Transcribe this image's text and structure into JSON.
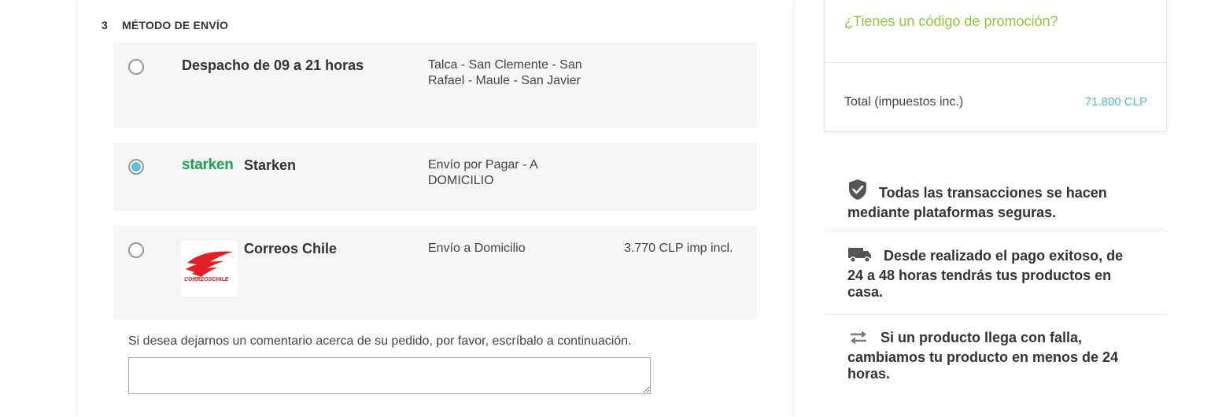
{
  "shipping": {
    "step_number": "3",
    "step_title": "MÉTODO DE ENVÍO",
    "options": [
      {
        "name": "Despacho de 09 a 21 horas",
        "description": "Talca - San Clemente - San Rafael - Maule - San Javier",
        "price": "",
        "selected": false
      },
      {
        "logo_text": "starken",
        "name": "Starken",
        "description": "Envío por Pagar - A DOMICILIO",
        "price": "",
        "selected": true
      },
      {
        "logo_text": "CORREOSCHILE",
        "name": "Correos Chile",
        "description": "Envío a Domicilio",
        "price": "3.770 CLP imp incl.",
        "selected": false
      }
    ],
    "comment_label": "Si desea dejarnos un comentario acerca de su pedido, por favor, escríbalo a continuación.",
    "comment_value": ""
  },
  "summary": {
    "promo_link": "¿Tienes un código de promoción?",
    "total_label": "Total (impuestos inc.)",
    "total_value": "71.800 CLP"
  },
  "guarantees": [
    {
      "icon": "shield-check-icon",
      "text": "Todas las transacciones se hacen mediante plataformas seguras."
    },
    {
      "icon": "truck-icon",
      "text": "Desde realizado el pago exitoso, de 24 a 48 horas tendrás tus productos en casa."
    },
    {
      "icon": "exchange-arrows-icon",
      "text": "Si un producto llega con falla, cambiamos tu producto en menos de 24 horas."
    }
  ],
  "colors": {
    "accent_blue": "#5bc0de",
    "promo_green": "#8cc63f",
    "starken_green": "#1aa254",
    "correos_red": "#e31e24",
    "option_bg": "#f5f5f5"
  }
}
